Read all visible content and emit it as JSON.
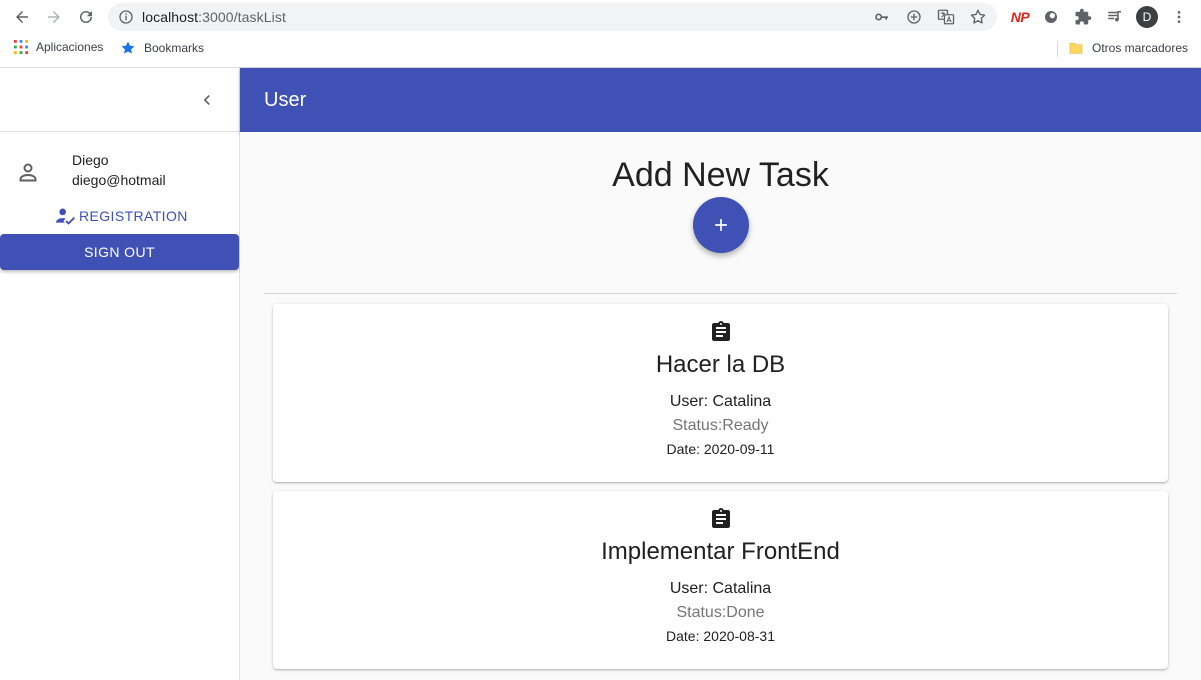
{
  "browser": {
    "url_host": "localhost",
    "url_path": ":3000/taskList",
    "profile_initial": "D",
    "extension_np": "NP",
    "bookmarks": {
      "apps": "Aplicaciones",
      "bookmarks": "Bookmarks",
      "other": "Otros marcadores"
    }
  },
  "sidebar": {
    "user_name": "Diego",
    "user_email": "diego@hotmail",
    "registration_label": "REGISTRATION",
    "signout_label": "SIGN OUT"
  },
  "appbar": {
    "title": "User"
  },
  "main": {
    "add_title": "Add New Task",
    "tasks": [
      {
        "title": "Hacer la DB",
        "user": "User: Catalina",
        "status": "Status:Ready",
        "date": "Date: 2020-09-11"
      },
      {
        "title": "Implementar FrontEnd",
        "user": "User: Catalina",
        "status": "Status:Done",
        "date": "Date: 2020-08-31"
      }
    ]
  },
  "colors": {
    "primary": "#3f51b5",
    "status_text": "#757575"
  },
  "icons": {
    "back": "arrow-left-icon",
    "forward": "arrow-right-icon",
    "reload": "reload-icon",
    "collapse": "chevron-left-icon",
    "user": "person-icon",
    "registration": "person-check-icon",
    "add": "plus-icon",
    "task": "clipboard-icon"
  }
}
